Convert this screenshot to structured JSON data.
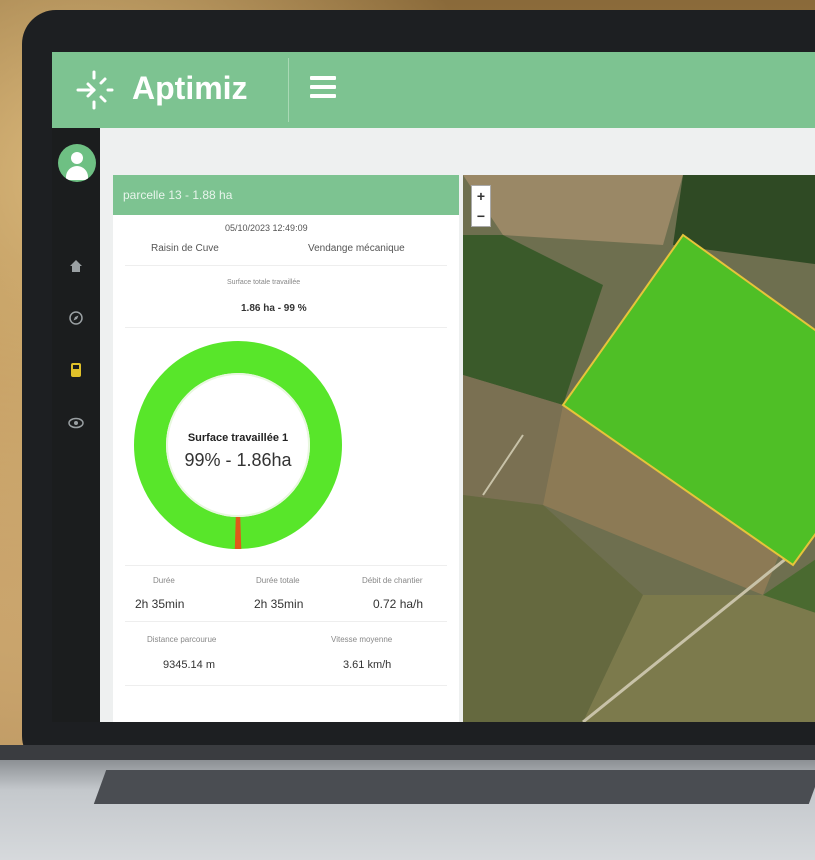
{
  "app": {
    "brand_name": "Aptimiz",
    "accent_color": "#7dc391"
  },
  "sidebar": {
    "items": [
      {
        "icon": "home-icon"
      },
      {
        "icon": "compass-icon"
      },
      {
        "icon": "tractor-icon"
      },
      {
        "icon": "eye-icon"
      }
    ]
  },
  "panel": {
    "header": "parcelle 13 - 1.88 ha",
    "datetime": "05/10/2023 12:49:09",
    "crop": "Raisin de Cuve",
    "operation": "Vendange mécanique",
    "surface_label": "Surface totale travaillée",
    "surface_value": "1.86 ha - 99 %",
    "donut": {
      "title": "Surface travaillée 1",
      "value": "99% - 1.86ha",
      "percent_worked": 99,
      "color_worked": "#58e62a",
      "color_remaining": "#e05a1a"
    },
    "stats_row1": [
      {
        "label": "Durée",
        "value": "2h 35min"
      },
      {
        "label": "Durée totale",
        "value": "2h 35min"
      },
      {
        "label": "Débit de chantier",
        "value": "0.72 ha/h"
      }
    ],
    "stats_row2": [
      {
        "label": "Distance parcourue",
        "value": "9345.14 m"
      },
      {
        "label": "Vitesse moyenne",
        "value": "3.61 km/h"
      }
    ]
  },
  "map": {
    "zoom_in": "+",
    "zoom_out": "−",
    "field_color": "#4fbf26"
  }
}
